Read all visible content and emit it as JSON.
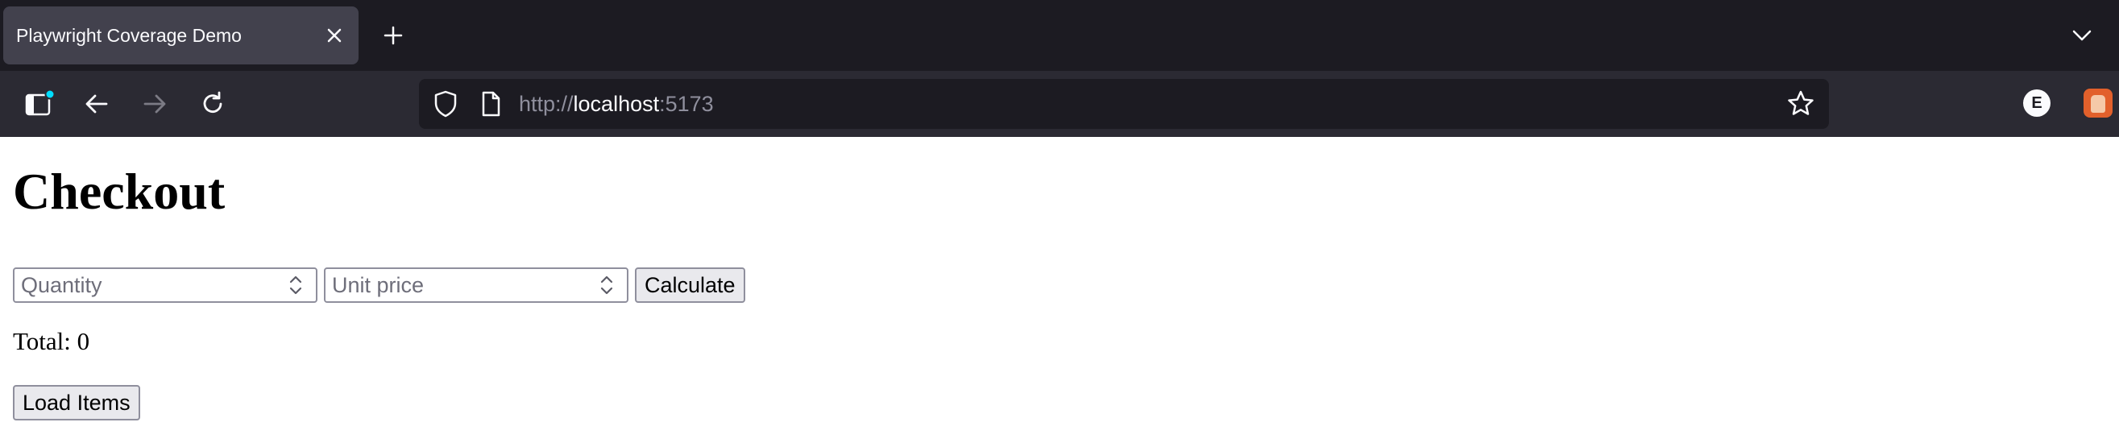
{
  "browser": {
    "tab": {
      "title": "Playwright Coverage Demo"
    },
    "url": {
      "scheme": "http://",
      "host": "localhost",
      "port": ":5173"
    },
    "extensions": {
      "e_badge": "E"
    },
    "icons": {
      "tab_close": "close-icon",
      "new_tab": "plus-icon",
      "tab_list": "chevron-down-icon",
      "sidebar": "sidebar-icon",
      "back": "arrow-left-icon",
      "forward": "arrow-right-icon",
      "reload": "reload-icon",
      "shield": "shield-icon",
      "page": "page-icon",
      "bookmark": "star-icon"
    },
    "colors": {
      "tabstrip": "#1c1b22",
      "toolbar": "#2b2a33",
      "active_tab": "#42414d",
      "accent_dot": "#00ddff",
      "extension_orange": "#e2602b"
    }
  },
  "page": {
    "title": "Checkout",
    "quantity": {
      "placeholder": "Quantity",
      "value": ""
    },
    "unit_price": {
      "placeholder": "Unit price",
      "value": ""
    },
    "calculate_label": "Calculate",
    "total_text": "Total: 0",
    "load_items_label": "Load Items"
  }
}
